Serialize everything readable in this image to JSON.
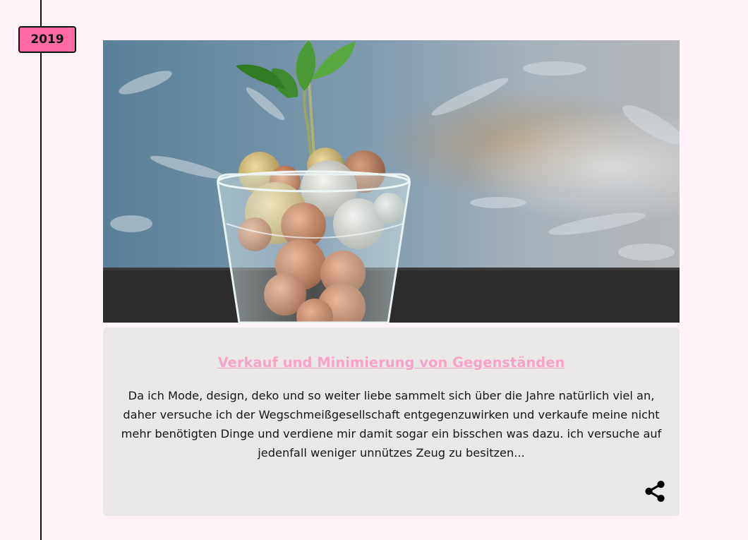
{
  "timeline": {
    "year": "2019"
  },
  "card": {
    "image_description_icon": "coins-glass-plant-photo",
    "title": "Verkauf und Minimierung von Gegenständen",
    "text": "Da ich Mode, design, deko und so weiter liebe sammelt sich über die Jahre natürlich viel an, daher versuche ich der Wegschmeißgesellschaft entgegenzuwirken und verkaufe meine nicht mehr benötigten Dinge und verdiene mir damit sogar ein bisschen was dazu. ich versuche auf jedenfall weniger unnützes Zeug zu besitzen...",
    "share_icon": "share-icon"
  },
  "colors": {
    "page_background": "#fff2f9",
    "badge_background": "#ff69a4",
    "title_color": "#f7a3c9",
    "card_background": "#eae8e7"
  }
}
